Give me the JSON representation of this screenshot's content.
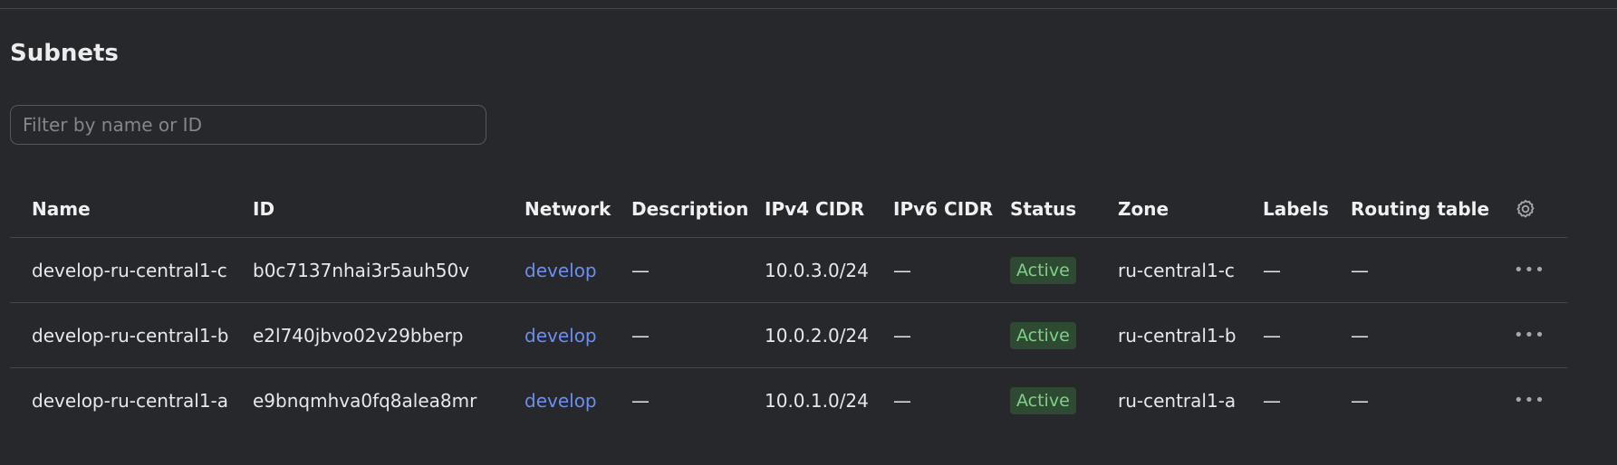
{
  "page": {
    "title": "Subnets"
  },
  "filter": {
    "placeholder": "Filter by name or ID",
    "value": ""
  },
  "table": {
    "headers": {
      "name": "Name",
      "id": "ID",
      "network": "Network",
      "description": "Description",
      "ipv4": "IPv4 CIDR",
      "ipv6": "IPv6 CIDR",
      "status": "Status",
      "zone": "Zone",
      "labels": "Labels",
      "routing": "Routing table"
    },
    "settings_icon": "gear-icon",
    "rows": [
      {
        "name": "develop-ru-central1-c",
        "id": "b0c7137nhai3r5auh50v",
        "network": "develop",
        "description": "—",
        "ipv4": "10.0.3.0/24",
        "ipv6": "—",
        "status": "Active",
        "zone": "ru-central1-c",
        "labels": "—",
        "routing": "—",
        "actions": "•••"
      },
      {
        "name": "develop-ru-central1-b",
        "id": "e2l740jbvo02v29bberp",
        "network": "develop",
        "description": "—",
        "ipv4": "10.0.2.0/24",
        "ipv6": "—",
        "status": "Active",
        "zone": "ru-central1-b",
        "labels": "—",
        "routing": "—",
        "actions": "•••"
      },
      {
        "name": "develop-ru-central1-a",
        "id": "e9bnqmhva0fq8alea8mr",
        "network": "develop",
        "description": "—",
        "ipv4": "10.0.1.0/24",
        "ipv6": "—",
        "status": "Active",
        "zone": "ru-central1-a",
        "labels": "—",
        "routing": "—",
        "actions": "•••"
      }
    ]
  },
  "colors": {
    "background": "#27282c",
    "link": "#6d8ef0",
    "status_active_bg": "#2f4a32",
    "status_active_text": "#7fd08a"
  }
}
